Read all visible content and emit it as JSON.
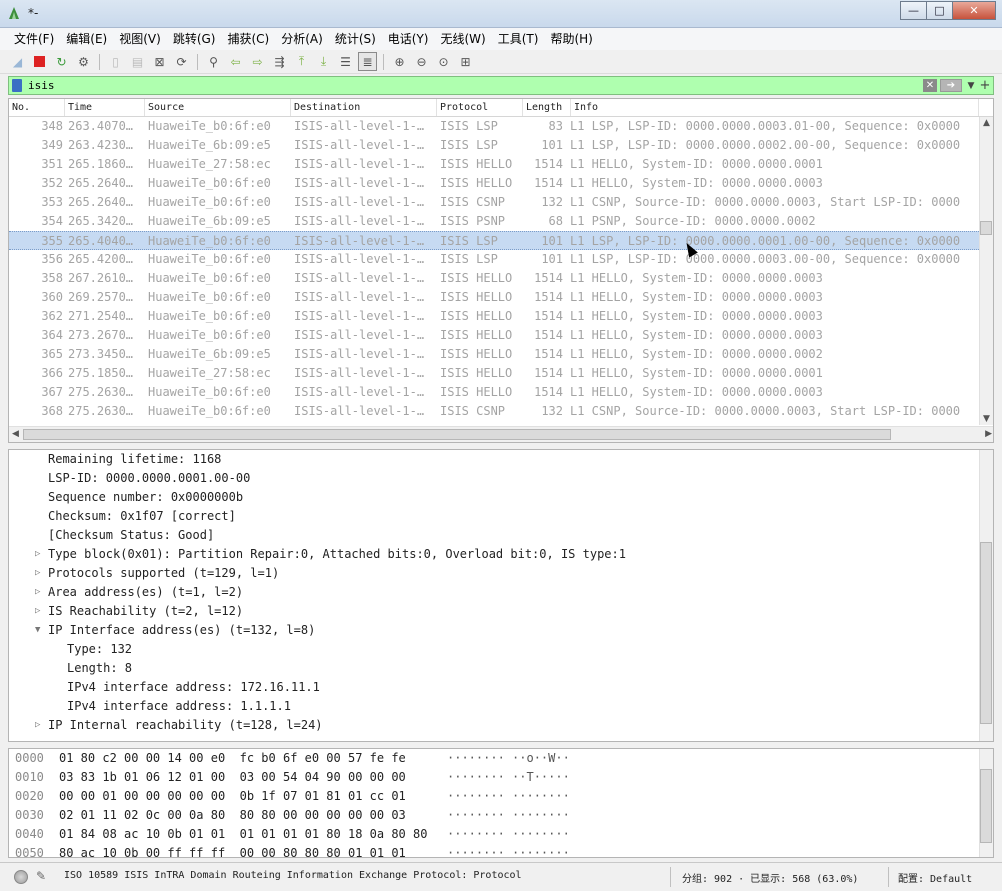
{
  "window": {
    "title": "*-",
    "minimize": "—",
    "maximize": "□",
    "close": "✕"
  },
  "menu": [
    "文件(F)",
    "编辑(E)",
    "视图(V)",
    "跳转(G)",
    "捕获(C)",
    "分析(A)",
    "统计(S)",
    "电话(Y)",
    "无线(W)",
    "工具(T)",
    "帮助(H)"
  ],
  "filter": {
    "value": "isis"
  },
  "columns": {
    "no": "No.",
    "time": "Time",
    "source": "Source",
    "destination": "Destination",
    "protocol": "Protocol",
    "length": "Length",
    "info": "Info"
  },
  "packets": [
    {
      "no": "348",
      "time": "263.4070…",
      "src": "HuaweiTe_b0:6f:e0",
      "dst": "ISIS-all-level-1-…",
      "proto": "ISIS LSP",
      "len": "83",
      "info": "L1 LSP, LSP-ID: 0000.0000.0003.01-00, Sequence: 0x0000"
    },
    {
      "no": "349",
      "time": "263.4230…",
      "src": "HuaweiTe_6b:09:e5",
      "dst": "ISIS-all-level-1-…",
      "proto": "ISIS LSP",
      "len": "101",
      "info": "L1 LSP, LSP-ID: 0000.0000.0002.00-00, Sequence: 0x0000"
    },
    {
      "no": "351",
      "time": "265.1860…",
      "src": "HuaweiTe_27:58:ec",
      "dst": "ISIS-all-level-1-…",
      "proto": "ISIS HELLO",
      "len": "1514",
      "info": "L1 HELLO, System-ID: 0000.0000.0001"
    },
    {
      "no": "352",
      "time": "265.2640…",
      "src": "HuaweiTe_b0:6f:e0",
      "dst": "ISIS-all-level-1-…",
      "proto": "ISIS HELLO",
      "len": "1514",
      "info": "L1 HELLO, System-ID: 0000.0000.0003"
    },
    {
      "no": "353",
      "time": "265.2640…",
      "src": "HuaweiTe_b0:6f:e0",
      "dst": "ISIS-all-level-1-…",
      "proto": "ISIS CSNP",
      "len": "132",
      "info": "L1 CSNP, Source-ID: 0000.0000.0003, Start LSP-ID: 0000"
    },
    {
      "no": "354",
      "time": "265.3420…",
      "src": "HuaweiTe_6b:09:e5",
      "dst": "ISIS-all-level-1-…",
      "proto": "ISIS PSNP",
      "len": "68",
      "info": "L1 PSNP, Source-ID: 0000.0000.0002"
    },
    {
      "no": "355",
      "time": "265.4040…",
      "src": "HuaweiTe_b0:6f:e0",
      "dst": "ISIS-all-level-1-…",
      "proto": "ISIS LSP",
      "len": "101",
      "info": "L1 LSP, LSP-ID: 0000.0000.0001.00-00, Sequence: 0x0000",
      "selected": true
    },
    {
      "no": "356",
      "time": "265.4200…",
      "src": "HuaweiTe_b0:6f:e0",
      "dst": "ISIS-all-level-1-…",
      "proto": "ISIS LSP",
      "len": "101",
      "info": "L1 LSP, LSP-ID: 0000.0000.0003.00-00, Sequence: 0x0000"
    },
    {
      "no": "358",
      "time": "267.2610…",
      "src": "HuaweiTe_b0:6f:e0",
      "dst": "ISIS-all-level-1-…",
      "proto": "ISIS HELLO",
      "len": "1514",
      "info": "L1 HELLO, System-ID: 0000.0000.0003"
    },
    {
      "no": "360",
      "time": "269.2570…",
      "src": "HuaweiTe_b0:6f:e0",
      "dst": "ISIS-all-level-1-…",
      "proto": "ISIS HELLO",
      "len": "1514",
      "info": "L1 HELLO, System-ID: 0000.0000.0003"
    },
    {
      "no": "362",
      "time": "271.2540…",
      "src": "HuaweiTe_b0:6f:e0",
      "dst": "ISIS-all-level-1-…",
      "proto": "ISIS HELLO",
      "len": "1514",
      "info": "L1 HELLO, System-ID: 0000.0000.0003"
    },
    {
      "no": "364",
      "time": "273.2670…",
      "src": "HuaweiTe_b0:6f:e0",
      "dst": "ISIS-all-level-1-…",
      "proto": "ISIS HELLO",
      "len": "1514",
      "info": "L1 HELLO, System-ID: 0000.0000.0003"
    },
    {
      "no": "365",
      "time": "273.3450…",
      "src": "HuaweiTe_6b:09:e5",
      "dst": "ISIS-all-level-1-…",
      "proto": "ISIS HELLO",
      "len": "1514",
      "info": "L1 HELLO, System-ID: 0000.0000.0002"
    },
    {
      "no": "366",
      "time": "275.1850…",
      "src": "HuaweiTe_27:58:ec",
      "dst": "ISIS-all-level-1-…",
      "proto": "ISIS HELLO",
      "len": "1514",
      "info": "L1 HELLO, System-ID: 0000.0000.0001"
    },
    {
      "no": "367",
      "time": "275.2630…",
      "src": "HuaweiTe_b0:6f:e0",
      "dst": "ISIS-all-level-1-…",
      "proto": "ISIS HELLO",
      "len": "1514",
      "info": "L1 HELLO, System-ID: 0000.0000.0003"
    },
    {
      "no": "368",
      "time": "275.2630…",
      "src": "HuaweiTe_b0:6f:e0",
      "dst": "ISIS-all-level-1-…",
      "proto": "ISIS CSNP",
      "len": "132",
      "info": "L1 CSNP, Source-ID: 0000.0000.0003, Start LSP-ID: 0000"
    }
  ],
  "details": [
    {
      "text": "Remaining lifetime: 1168",
      "indent": 1,
      "expander": ""
    },
    {
      "text": "LSP-ID: 0000.0000.0001.00-00",
      "indent": 1,
      "expander": ""
    },
    {
      "text": "Sequence number: 0x0000000b",
      "indent": 1,
      "expander": ""
    },
    {
      "text": "Checksum: 0x1f07 [correct]",
      "indent": 1,
      "expander": ""
    },
    {
      "text": "[Checksum Status: Good]",
      "indent": 1,
      "expander": ""
    },
    {
      "text": "Type block(0x01): Partition Repair:0, Attached bits:0, Overload bit:0, IS type:1",
      "indent": 1,
      "expander": "collapsed"
    },
    {
      "text": "Protocols supported (t=129, l=1)",
      "indent": 1,
      "expander": "collapsed"
    },
    {
      "text": "Area address(es) (t=1, l=2)",
      "indent": 1,
      "expander": "collapsed"
    },
    {
      "text": "IS Reachability (t=2, l=12)",
      "indent": 1,
      "expander": "collapsed"
    },
    {
      "text": "IP Interface address(es) (t=132, l=8)",
      "indent": 1,
      "expander": "expanded"
    },
    {
      "text": "Type: 132",
      "indent": 2,
      "expander": ""
    },
    {
      "text": "Length: 8",
      "indent": 2,
      "expander": ""
    },
    {
      "text": "IPv4 interface address: 172.16.11.1",
      "indent": 2,
      "expander": ""
    },
    {
      "text": "IPv4 interface address: 1.1.1.1",
      "indent": 2,
      "expander": ""
    },
    {
      "text": "IP Internal reachability (t=128, l=24)",
      "indent": 1,
      "expander": "collapsed"
    }
  ],
  "bytes": [
    {
      "offset": "0000",
      "hex": "01 80 c2 00 00 14 00 e0  fc b0 6f e0 00 57 fe fe",
      "ascii": "········ ··o··W··"
    },
    {
      "offset": "0010",
      "hex": "03 83 1b 01 06 12 01 00  03 00 54 04 90 00 00 00",
      "ascii": "········ ··T·····"
    },
    {
      "offset": "0020",
      "hex": "00 00 01 00 00 00 00 00  0b 1f 07 01 81 01 cc 01",
      "ascii": "········ ········"
    },
    {
      "offset": "0030",
      "hex": "02 01 11 02 0c 00 0a 80  80 80 00 00 00 00 00 03",
      "ascii": "········ ········"
    },
    {
      "offset": "0040",
      "hex": "01 84 08 ac 10 0b 01 01  01 01 01 01 80 18 0a 80 80",
      "ascii": "········ ········"
    },
    {
      "offset": "0050",
      "hex": "80 ac 10 0b 00 ff ff ff  00 00 80 80 80 01 01 01",
      "ascii": "········ ········"
    }
  ],
  "status": {
    "description": "ISO 10589 ISIS InTRA Domain Routeing Information Exchange Protocol: Protocol",
    "counts": "分组: 902 · 已显示: 568 (63.0%)",
    "profile": "配置: Default"
  }
}
